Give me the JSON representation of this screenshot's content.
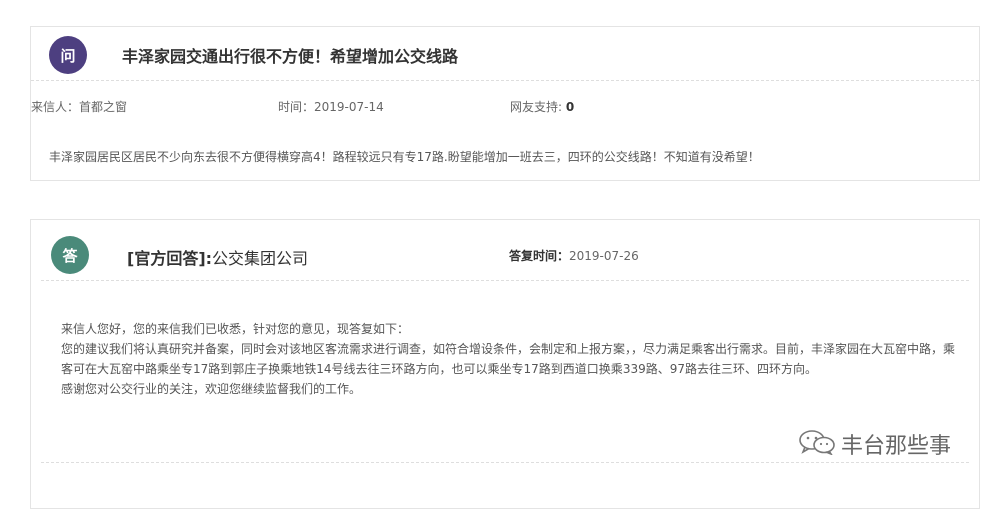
{
  "question": {
    "badge": "问",
    "title": "丰泽家园交通出行很不方便！希望增加公交线路",
    "sender_label": "来信人：",
    "sender": "首都之窗",
    "time_label": "时间：",
    "time": "2019-07-14",
    "support_label": "网友支持: ",
    "support": "0",
    "body": "丰泽家园居民区居民不少向东去很不方便得横穿高4！路程较远只有专17路.盼望能增加一班去三，四环的公交线路！不知道有没希望！"
  },
  "answer": {
    "badge": "答",
    "tag": "[官方回答]:",
    "org": "公交集团公司",
    "time_label": "答复时间：",
    "time": "2019-07-26",
    "paragraphs": [
      "来信人您好，您的来信我们已收悉，针对您的意见，现答复如下：",
      "您的建议我们将认真研究并备案，同时会对该地区客流需求进行调查，如符合增设条件，会制定和上报方案，，尽力满足乘客出行需求。目前，丰泽家园在大瓦窑中路，乘客可在大瓦窑中路乘坐专17路到郭庄子换乘地铁14号线去往三环路方向，也可以乘坐专17路到西道口换乘339路、97路去往三环、四环方向。",
      "感谢您对公交行业的关注，欢迎您继续监督我们的工作。"
    ]
  },
  "watermark": {
    "text": "丰台那些事",
    "icon": "wechat-icon"
  }
}
